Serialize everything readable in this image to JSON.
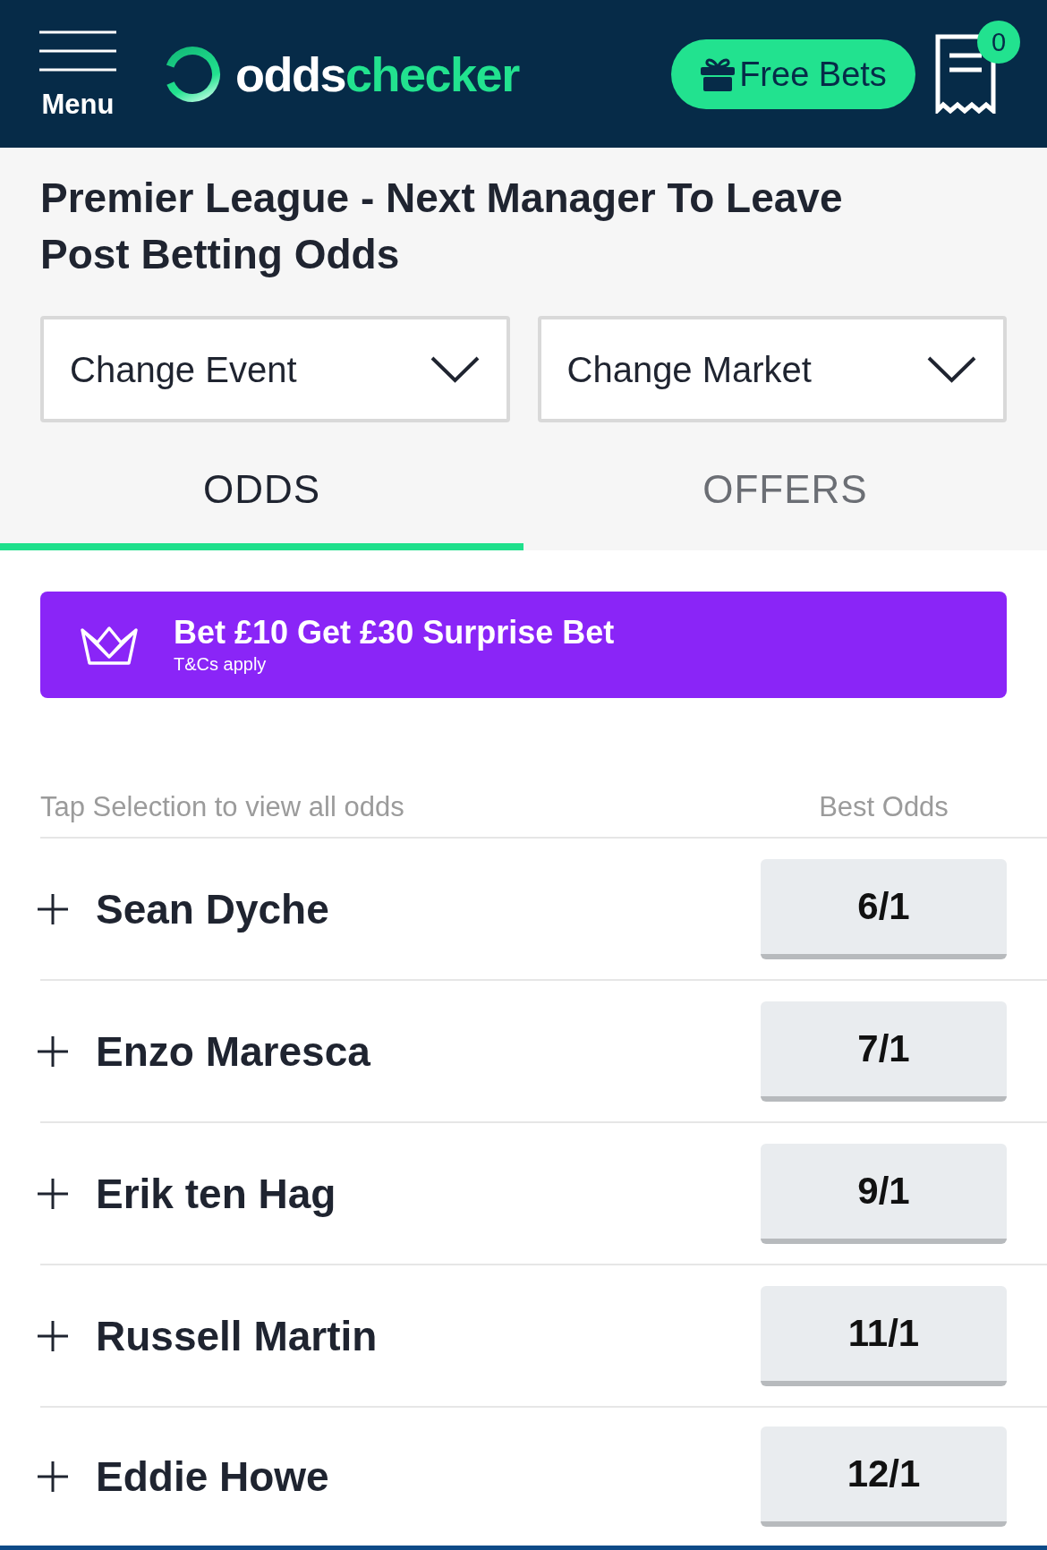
{
  "header": {
    "menu_label": "Menu",
    "logo": {
      "first": "odds",
      "second": "checker"
    },
    "free_bets_button": {
      "label": "Free Bets"
    },
    "bet_slip": {
      "count": "0"
    }
  },
  "page_title": "Premier League - Next Manager To Leave Post Betting Odds",
  "dropdowns": [
    {
      "label": "Change Event"
    },
    {
      "label": "Change Market"
    }
  ],
  "tabs": [
    {
      "label": "ODDS",
      "selected": true
    },
    {
      "label": "OFFERS",
      "selected": false
    }
  ],
  "promo_banner": {
    "title": "Bet £10 Get £30 Surprise Bet",
    "terms": "T&Cs apply"
  },
  "selections": {
    "hint": "Tap Selection to view all odds",
    "odds_heading": "Best Odds",
    "rows": [
      {
        "name": "Sean Dyche",
        "best_odds": "6/1"
      },
      {
        "name": "Enzo Maresca",
        "best_odds": "7/1"
      },
      {
        "name": "Erik ten Hag",
        "best_odds": "9/1"
      },
      {
        "name": "Russell Martin",
        "best_odds": "11/1"
      },
      {
        "name": "Eddie Howe",
        "best_odds": "12/1"
      }
    ]
  }
}
